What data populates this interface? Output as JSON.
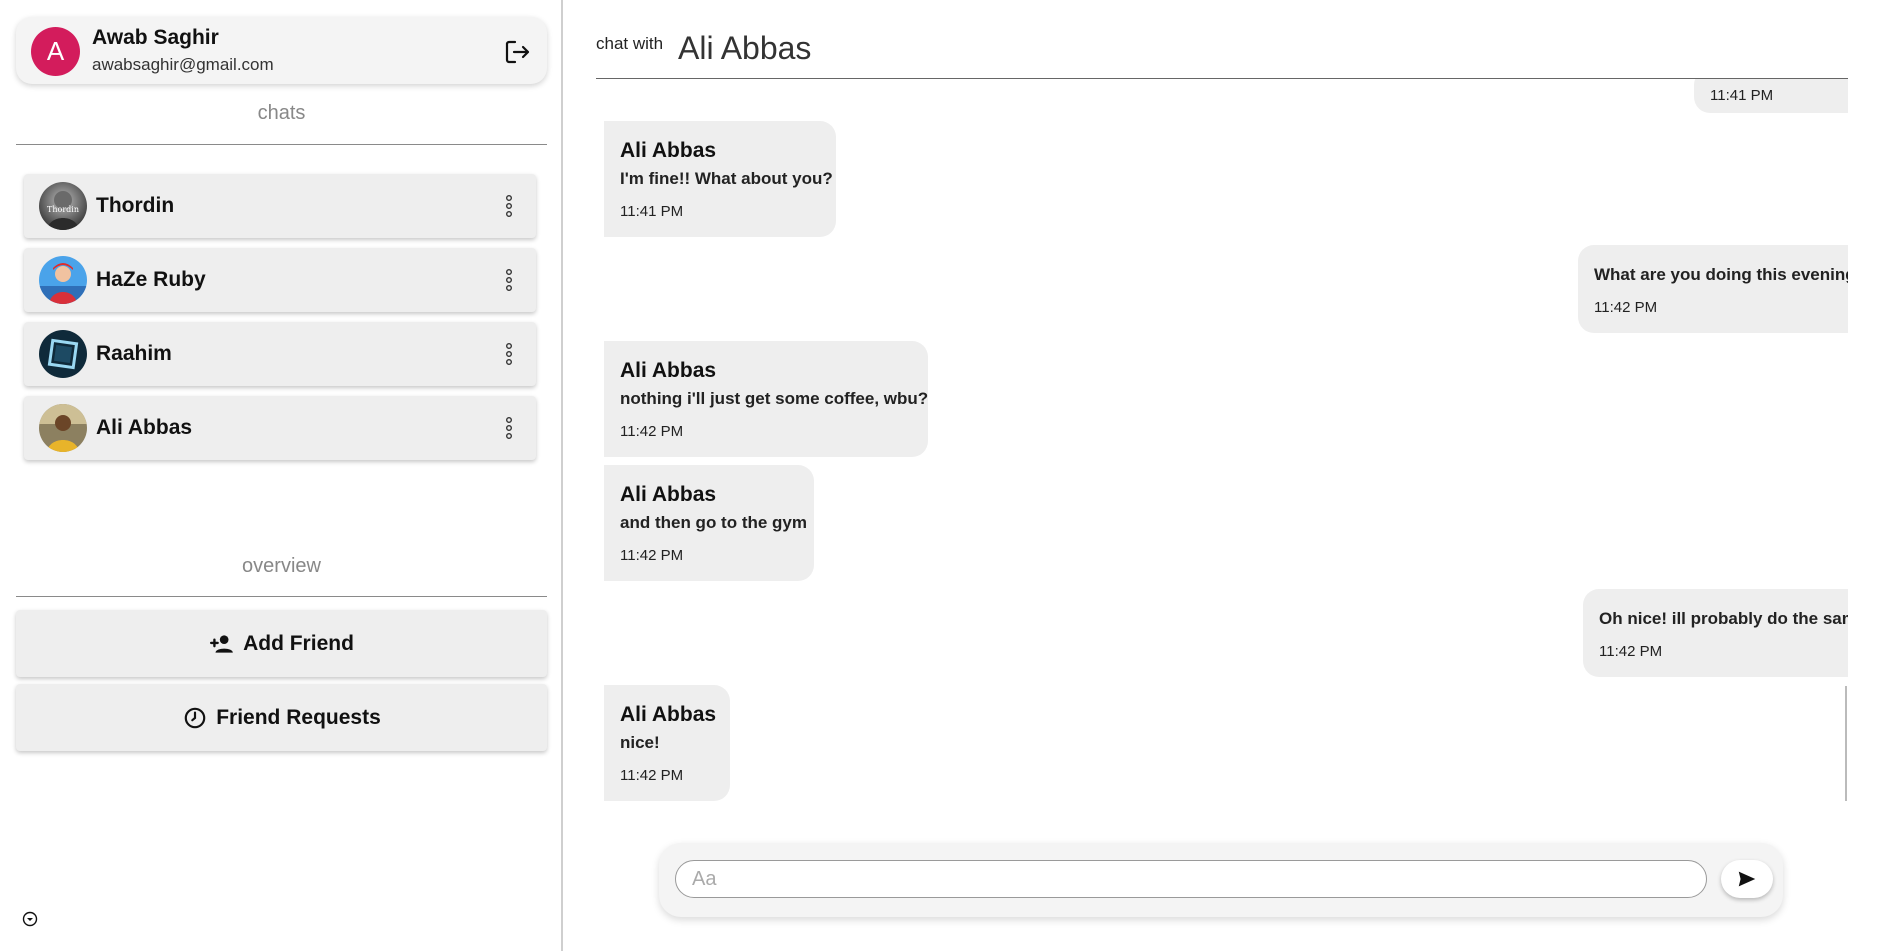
{
  "user": {
    "initial": "A",
    "name": "Awab Saghir",
    "email": "awabsaghir@gmail.com",
    "avatar_color": "#d31c5c"
  },
  "sidebar": {
    "chats_label": "chats",
    "overview_label": "overview",
    "chats": [
      {
        "name": "Thordin",
        "avatar": "grayscale-photo",
        "badge": "Thordin"
      },
      {
        "name": "HaZe Ruby",
        "avatar": "blue-photo"
      },
      {
        "name": "Raahim",
        "avatar": "dark-cube-photo"
      },
      {
        "name": "Ali Abbas",
        "avatar": "portrait-photo"
      }
    ],
    "add_friend_label": "Add Friend",
    "friend_requests_label": "Friend Requests"
  },
  "chat": {
    "with_label": "chat with",
    "title": "Ali Abbas",
    "messages": [
      {
        "dir": "out",
        "time": "11:41 PM"
      },
      {
        "dir": "in",
        "sender": "Ali Abbas",
        "text": "I'm fine!! What about you?",
        "time": "11:41 PM"
      },
      {
        "dir": "out",
        "text": "What are you doing this evening?",
        "time": "11:42 PM"
      },
      {
        "dir": "in",
        "sender": "Ali Abbas",
        "text": "nothing i'll just get some coffee, wbu?",
        "time": "11:42 PM"
      },
      {
        "dir": "in",
        "sender": "Ali Abbas",
        "text": "and then go to the gym",
        "time": "11:42 PM"
      },
      {
        "dir": "out",
        "text": "Oh nice! ill probably do the same",
        "time": "11:42 PM"
      },
      {
        "dir": "in",
        "sender": "Ali Abbas",
        "text": "nice!",
        "time": "11:42 PM"
      }
    ],
    "composer_placeholder": "Aa"
  },
  "colors": {
    "bubble": "#eeeeee",
    "accent": "#d31c5c"
  }
}
